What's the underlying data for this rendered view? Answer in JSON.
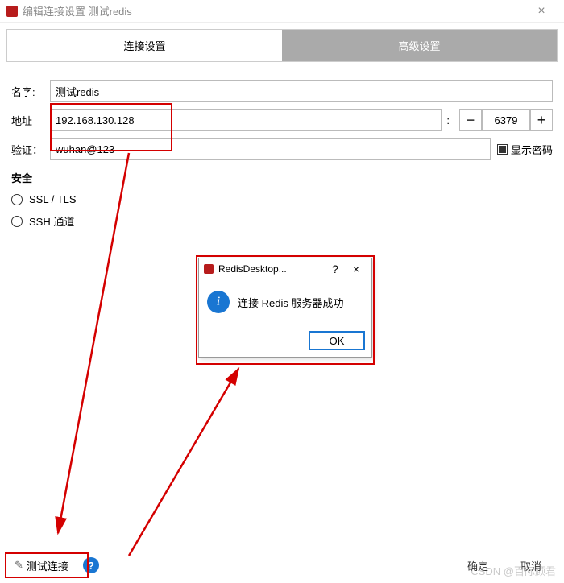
{
  "window": {
    "title": "编辑连接设置 测试redis"
  },
  "tabs": {
    "conn": "连接设置",
    "adv": "高级设置"
  },
  "form": {
    "name_label": "名字:",
    "name_value": "测试redis",
    "addr_label": "地址",
    "addr_value": "192.168.130.128",
    "port_value": "6379",
    "auth_label": "验证：",
    "auth_value": "wuhan@123",
    "show_pwd": "显示密码"
  },
  "security": {
    "title": "安全",
    "ssl": "SSL / TLS",
    "ssh": "SSH 通道"
  },
  "dialog": {
    "title": "RedisDesktop...",
    "message": "连接 Redis 服务器成功",
    "ok": "OK"
  },
  "footer": {
    "test": "测试连接",
    "ok": "确定",
    "cancel": "取消"
  },
  "watermark": "CSDN @百际顾君"
}
